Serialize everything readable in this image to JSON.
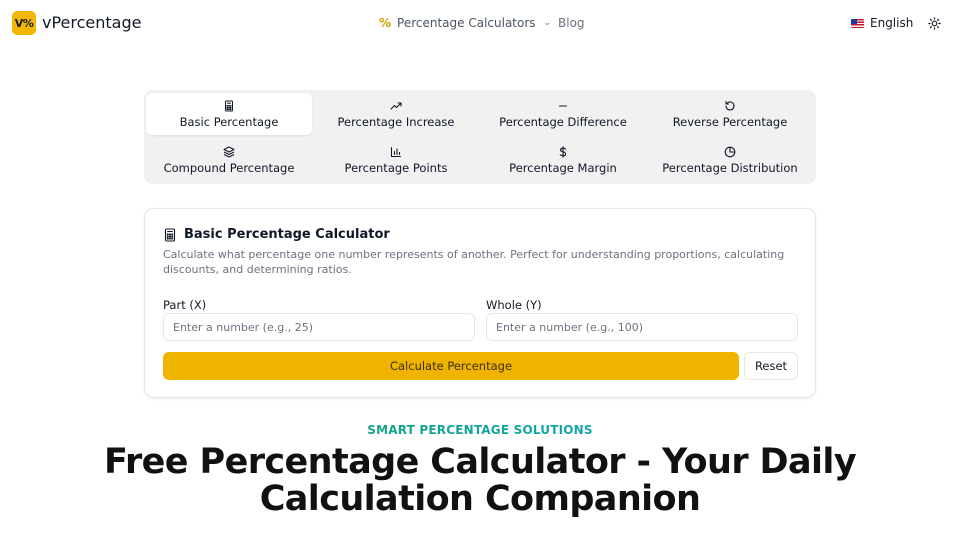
{
  "header": {
    "logo_text": "V%",
    "brand": "vPercentage",
    "nav_calculators_icon": "%",
    "nav_calculators": "Percentage Calculators",
    "nav_blog": "Blog",
    "language": "English"
  },
  "tabs": [
    {
      "label": "Basic Percentage",
      "icon": "calculator-icon",
      "active": true
    },
    {
      "label": "Percentage Increase",
      "icon": "trending-up-icon"
    },
    {
      "label": "Percentage Difference",
      "icon": "minus-icon"
    },
    {
      "label": "Reverse Percentage",
      "icon": "rotate-ccw-icon"
    },
    {
      "label": "Compound Percentage",
      "icon": "layers-icon"
    },
    {
      "label": "Percentage Points",
      "icon": "bar-chart-icon"
    },
    {
      "label": "Percentage Margin",
      "icon": "dollar-icon"
    },
    {
      "label": "Percentage Distribution",
      "icon": "pie-chart-icon"
    }
  ],
  "calculator": {
    "title": "Basic Percentage Calculator",
    "description": "Calculate what percentage one number represents of another. Perfect for understanding proportions, calculating discounts, and determining ratios.",
    "part_label": "Part (X)",
    "part_placeholder": "Enter a number (e.g., 25)",
    "whole_label": "Whole (Y)",
    "whole_placeholder": "Enter a number (e.g., 100)",
    "calculate_label": "Calculate Percentage",
    "reset_label": "Reset"
  },
  "hero": {
    "eyebrow": "SMART PERCENTAGE SOLUTIONS",
    "title": "Free Percentage Calculator - Your Daily Calculation Companion"
  },
  "colors": {
    "accent": "#f0b400",
    "eyebrow_start": "#16a34a",
    "eyebrow_end": "#0ea5e9"
  }
}
